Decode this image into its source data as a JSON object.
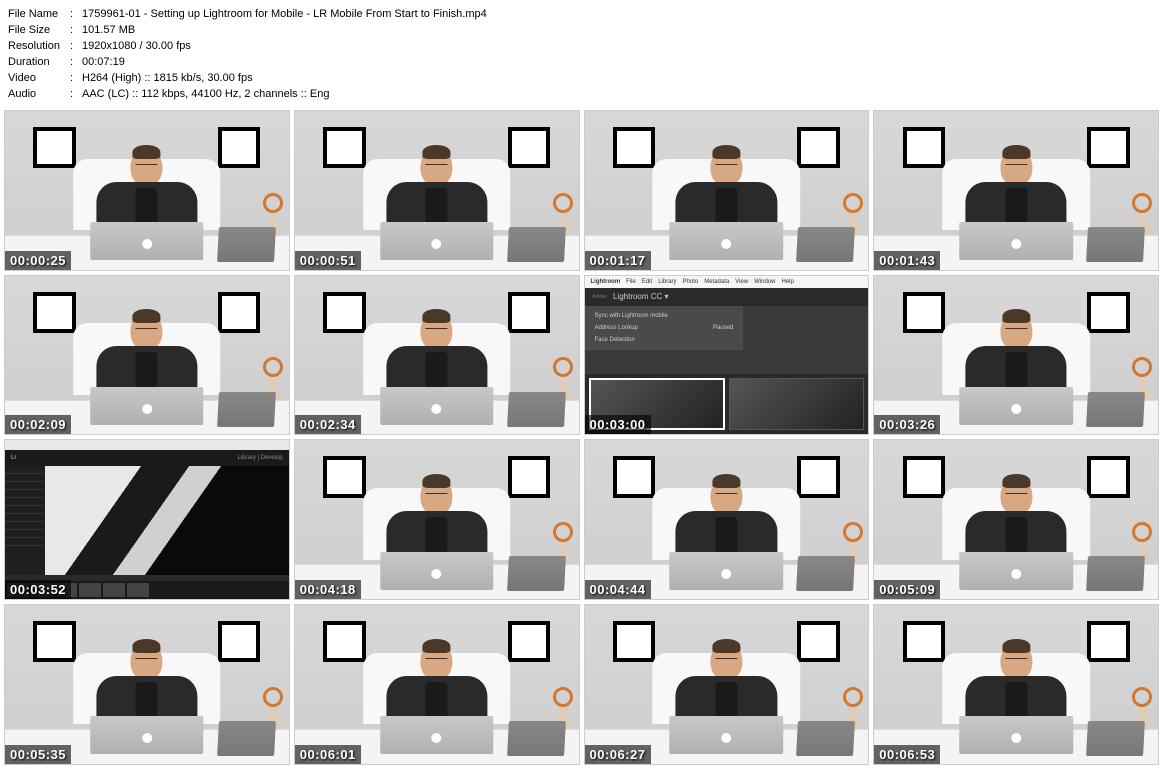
{
  "metadata": {
    "fileName": {
      "label": "File Name",
      "value": "1759961-01 - Setting up Lightroom for Mobile - LR Mobile From Start to Finish.mp4"
    },
    "fileSize": {
      "label": "File Size",
      "value": "101.57 MB"
    },
    "resolution": {
      "label": "Resolution",
      "value": "1920x1080 / 30.00 fps"
    },
    "duration": {
      "label": "Duration",
      "value": "00:07:19"
    },
    "video": {
      "label": "Video",
      "value": "H264 (High) :: 1815 kb/s, 30.00 fps"
    },
    "audio": {
      "label": "Audio",
      "value": "AAC (LC) :: 112 kbps, 44100 Hz, 2 channels :: Eng"
    }
  },
  "timestamps": [
    "00:00:25",
    "00:00:51",
    "00:01:17",
    "00:01:43",
    "00:02:09",
    "00:02:34",
    "00:03:00",
    "00:03:26",
    "00:03:52",
    "00:04:18",
    "00:04:44",
    "00:05:09",
    "00:05:35",
    "00:06:01",
    "00:06:27",
    "00:06:53"
  ],
  "lightroom_menu": {
    "app": "Lightroom",
    "items": [
      "File",
      "Edit",
      "Library",
      "Photo",
      "Metadata",
      "View",
      "Window",
      "Help"
    ],
    "brand_prefix": "Adobe",
    "brand": "Lightroom CC",
    "arrow": "▾",
    "dropdown": [
      {
        "label": "Sync with Lightroom mobile",
        "status": ""
      },
      {
        "label": "Address Lookup",
        "status": "Paused"
      },
      {
        "label": "Face Detection",
        "status": ""
      }
    ]
  },
  "lightroom_full": {
    "module_left": "Library",
    "module_right": "Develop"
  }
}
